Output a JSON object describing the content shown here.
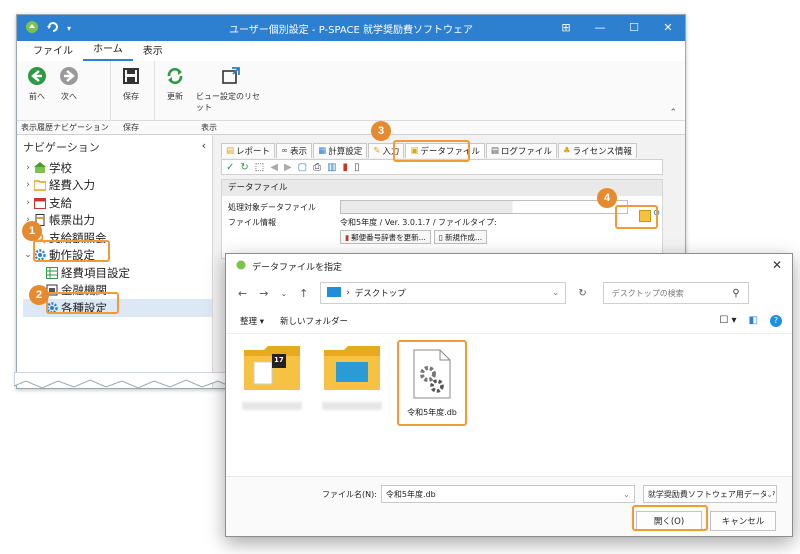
{
  "window": {
    "title": "ユーザー個別設定 - P-SPACE 就学奨励費ソフトウェア",
    "controls": [
      "⊞",
      "—",
      "☐",
      "✕"
    ]
  },
  "ribbon": {
    "tabs": [
      "ファイル",
      "ホーム",
      "表示"
    ],
    "active_tab": "ホーム",
    "buttons": {
      "back": "前へ",
      "forward": "次へ",
      "save": "保存",
      "refresh": "更新",
      "reset_view": "ビュー設定のリセット"
    },
    "groups": [
      "表示履歴ナビゲーション",
      "保存",
      "表示"
    ]
  },
  "nav": {
    "title": "ナビゲーション",
    "collapse": "‹",
    "items": [
      {
        "label": "学校",
        "chev": "›"
      },
      {
        "label": "経費入力",
        "chev": "›"
      },
      {
        "label": "支給",
        "chev": "›"
      },
      {
        "label": "帳票出力",
        "chev": "›"
      },
      {
        "label": "支給額照会",
        "chev": ""
      },
      {
        "label": "動作設定",
        "chev": "⌄"
      },
      {
        "label": "経費項目設定",
        "chev": ""
      },
      {
        "label": "金融機関",
        "chev": ""
      },
      {
        "label": "各種設定",
        "chev": ""
      }
    ]
  },
  "content": {
    "tabs": [
      "レポート",
      "表示",
      "計算設定",
      "入力",
      "データファイル",
      "ログファイル",
      "ライセンス情報"
    ],
    "section": "データファイル",
    "target_label": "処理対象データファイル",
    "info_label": "ファイル情報",
    "info_value": "令和5年度 / Ver. 3.0.1.7 / ファイルタイプ:",
    "btn_update": "郵便番号辞書を更新...",
    "btn_new": "新規作成..."
  },
  "dialog": {
    "title": "データファイルを指定",
    "close": "✕",
    "path": "デスクトップ",
    "search_placeholder": "デスクトップの検索",
    "organize": "整理 ▾",
    "new_folder": "新しいフォルダー",
    "files": [
      {
        "label": "",
        "type": "folder-calendar",
        "badge": "17"
      },
      {
        "label": "",
        "type": "folder-photo"
      },
      {
        "label": "令和5年度.db",
        "type": "db"
      }
    ],
    "filename_label": "ファイル名(N):",
    "filename_value": "令和5年度.db",
    "filetype": "就学奨励費ソフトウェア用データファイル",
    "open_button": "開く(O)",
    "cancel_button": "キャンセル"
  },
  "callouts": [
    "1",
    "2",
    "3",
    "4"
  ],
  "colors": {
    "accent": "#2d7fd0",
    "highlight": "#f29a36",
    "badge": "#e58a2e"
  }
}
